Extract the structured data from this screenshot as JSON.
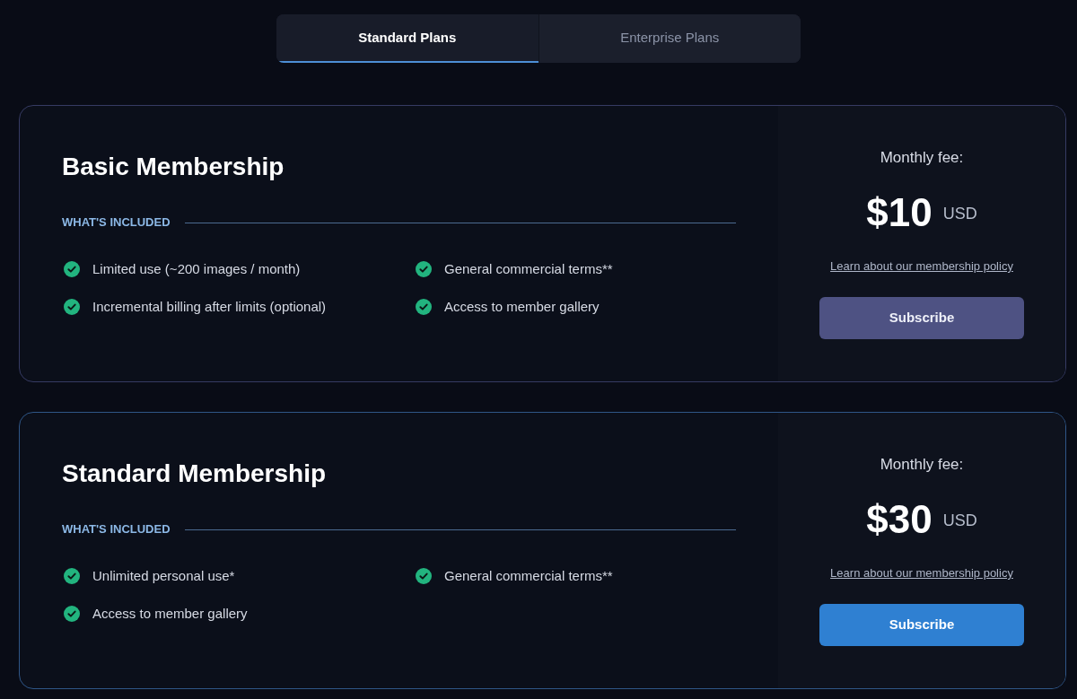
{
  "tabs": [
    {
      "label": "Standard Plans",
      "selected": true
    },
    {
      "label": "Enterprise Plans",
      "selected": false
    }
  ],
  "plans": [
    {
      "name": "Basic Membership",
      "featured": false,
      "included_heading": "WHAT'S INCLUDED",
      "features": [
        "Limited use (~200 images / month)",
        "General commercial terms**",
        "Incremental billing after limits (optional)",
        "Access to member gallery"
      ],
      "fee_label": "Monthly fee:",
      "price": "$10",
      "currency": "USD",
      "policy_link": "Learn about our membership policy",
      "button": "Subscribe"
    },
    {
      "name": "Standard Membership",
      "featured": true,
      "included_heading": "WHAT'S INCLUDED",
      "features": [
        "Unlimited personal use*",
        "General commercial terms**",
        "Access to member gallery"
      ],
      "fee_label": "Monthly fee:",
      "price": "$30",
      "currency": "USD",
      "policy_link": "Learn about our membership policy",
      "button": "Subscribe"
    }
  ]
}
